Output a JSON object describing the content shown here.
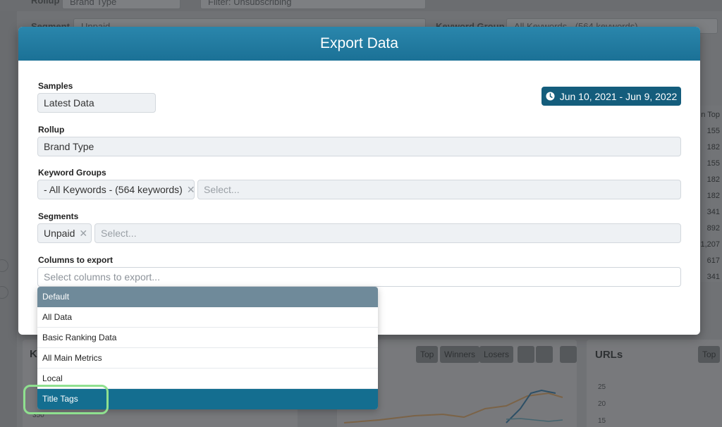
{
  "background": {
    "rollup_label": "Rollup",
    "rollup_value": "Brand Type",
    "filter_value": "Filter: Unsubscribing",
    "segment_label": "Segment",
    "segment_value": "Unpaid",
    "keyword_group_label": "Keyword Group",
    "keyword_group_value": "All Keywords - (564 keywords)",
    "column_header": "n Top",
    "column_values": [
      "155",
      "182",
      "155",
      "182",
      "182",
      "341",
      "892",
      "1,207",
      "617",
      "341"
    ],
    "chart_tabs": [
      "Top",
      "Winners",
      "Losers"
    ],
    "urls_title": "URLs",
    "urls_top_tab": "Top",
    "left_card_title": "K",
    "left_axis_label": "350",
    "urls_axis": [
      "25",
      "20",
      "15"
    ]
  },
  "modal": {
    "title": "Export Data",
    "date_range": "Jun 10, 2021 - Jun 9, 2022",
    "samples": {
      "label": "Samples",
      "value": "Latest Data"
    },
    "rollup": {
      "label": "Rollup",
      "value": "Brand Type"
    },
    "keyword_groups": {
      "label": "Keyword Groups",
      "chip": "- All Keywords - (564 keywords)",
      "placeholder": "Select..."
    },
    "segments": {
      "label": "Segments",
      "chip": "Unpaid",
      "placeholder": "Select..."
    },
    "columns": {
      "label": "Columns to export",
      "placeholder": "Select columns to export..."
    }
  },
  "dropdown": {
    "group_label": "Default",
    "options": [
      "All Data",
      "Basic Ranking Data",
      "All Main Metrics",
      "Local"
    ],
    "active_option": "Title Tags"
  },
  "colors": {
    "header": "#1f7aa0",
    "date_button": "#145d7c",
    "dropdown_group": "#6f8a9a",
    "dropdown_active": "#146e90",
    "highlight_ring": "#8fe08f"
  }
}
